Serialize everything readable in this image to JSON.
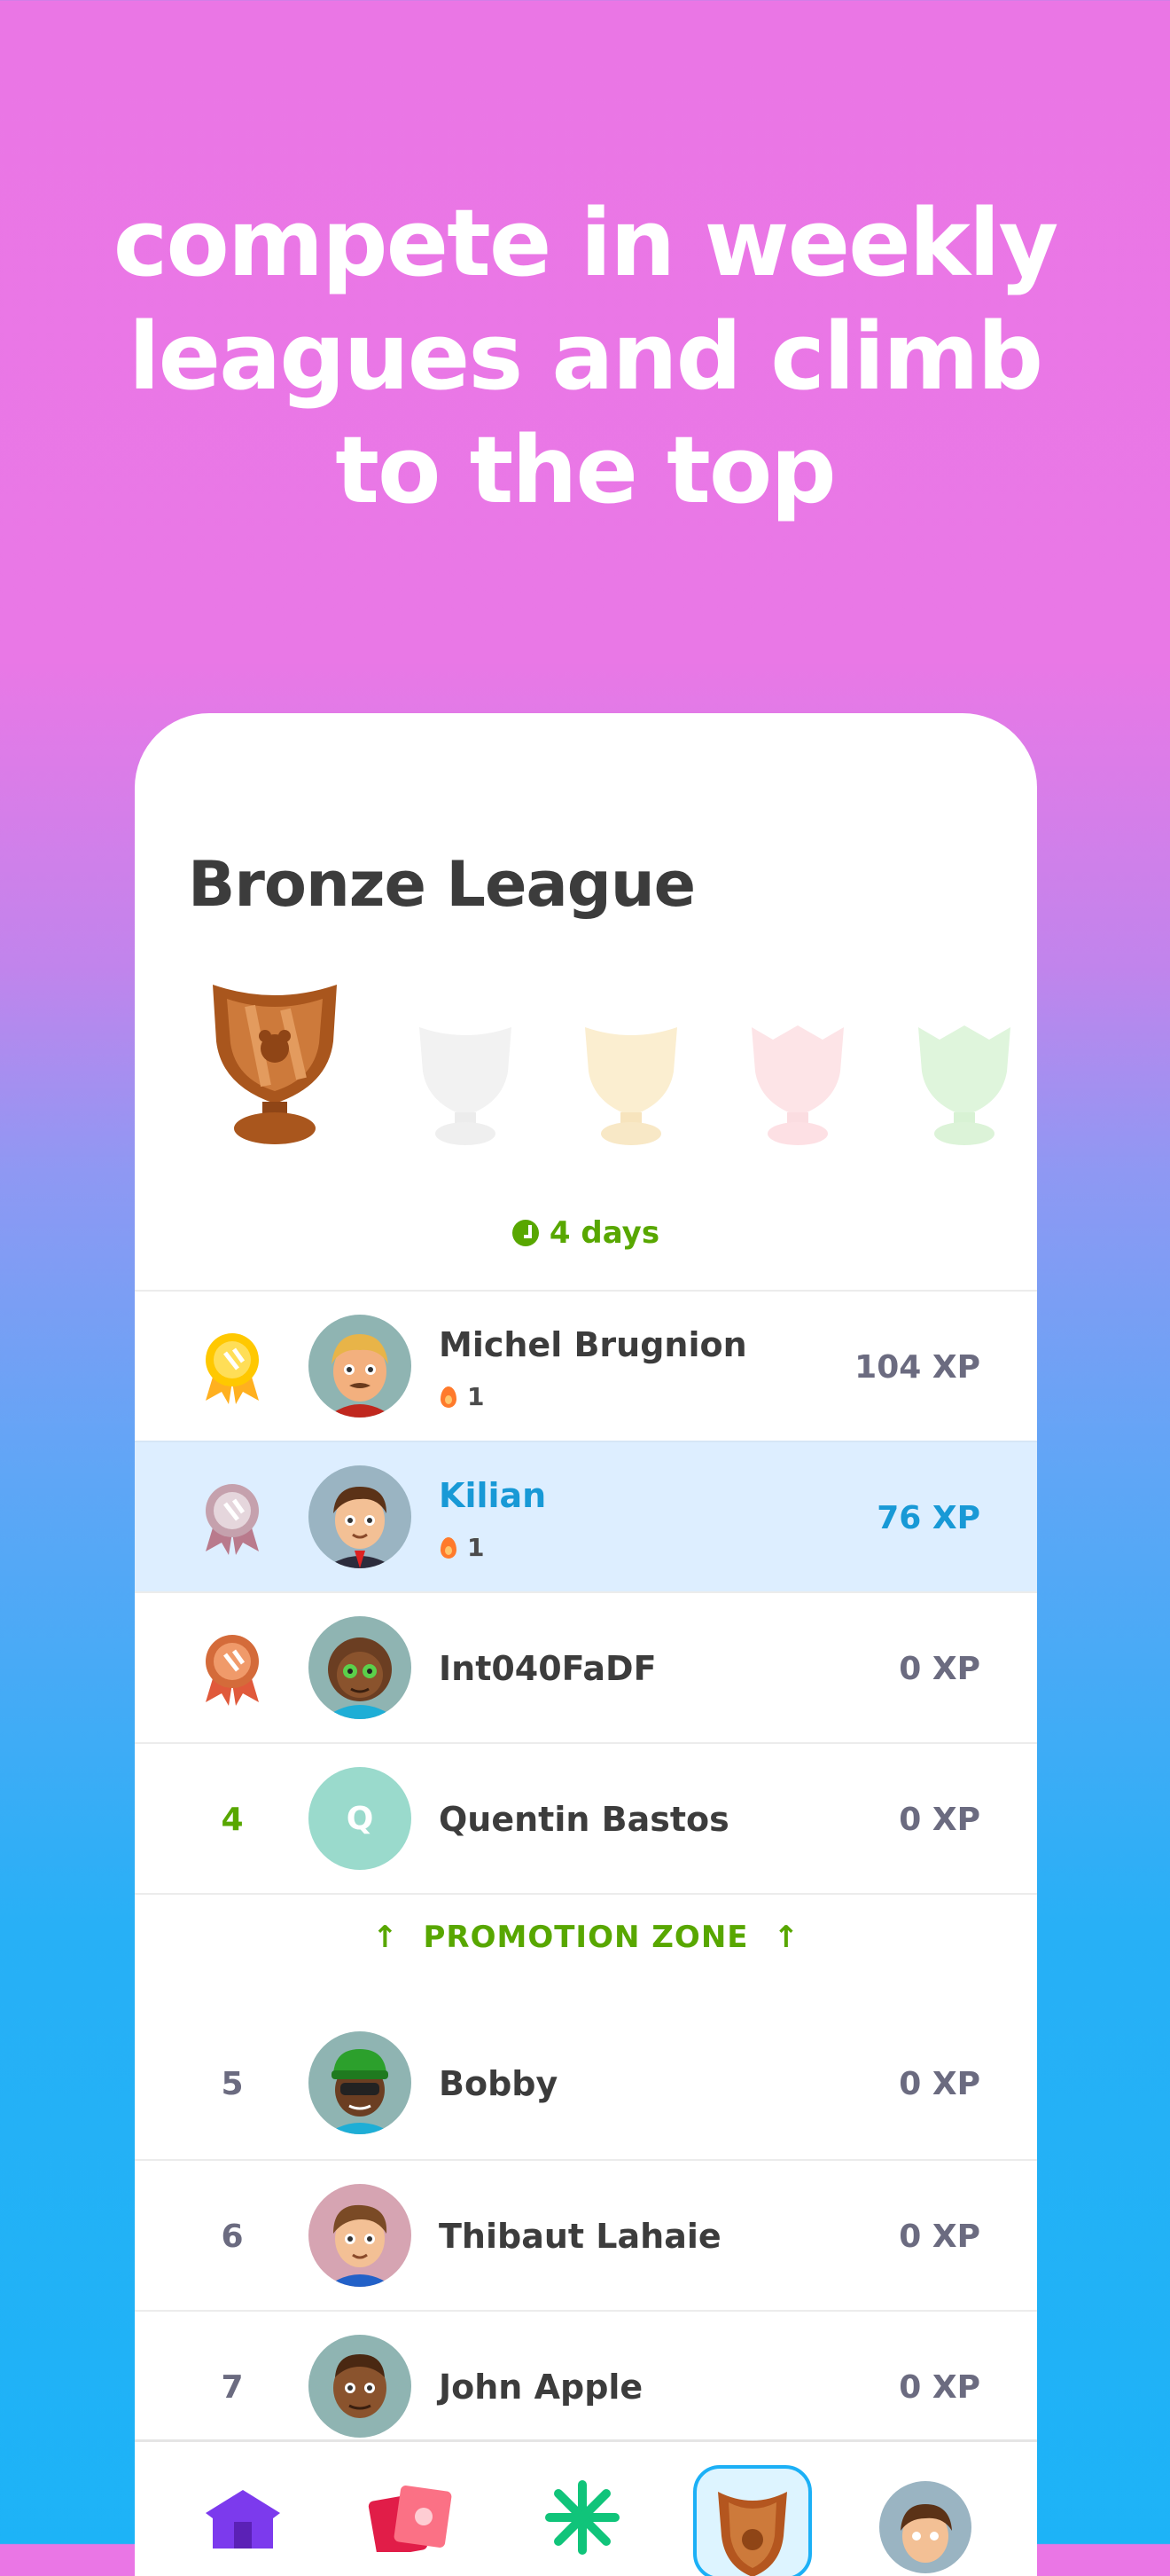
{
  "headline": [
    "compete in weekly",
    "leagues and climb",
    "to the top"
  ],
  "league": {
    "title": "Bronze League",
    "timer": "4 days",
    "promotion_zone_label": "PROMOTION ZONE",
    "xp_unit": "XP"
  },
  "leaderboard": [
    {
      "rank": "1",
      "name": "Michel Brugnion",
      "streak": "1",
      "xp": "104 XP",
      "medal": "gold"
    },
    {
      "rank": "2",
      "name": "Kilian",
      "streak": "1",
      "xp": "76 XP",
      "medal": "silver",
      "current_user": true
    },
    {
      "rank": "3",
      "name": "Int040FaDF",
      "xp": "0 XP",
      "medal": "bronze"
    },
    {
      "rank": "4",
      "name": "Quentin Bastos",
      "avatar_letter": "Q",
      "xp": "0 XP"
    },
    {
      "rank": "5",
      "name": "Bobby",
      "xp": "0 XP"
    },
    {
      "rank": "6",
      "name": "Thibaut Lahaie",
      "xp": "0 XP"
    },
    {
      "rank": "7",
      "name": "John Apple",
      "xp": "0 XP"
    }
  ],
  "colors": {
    "accent_green": "#58a700",
    "current_user_blue": "#1899d6",
    "current_user_bg": "#ddeeff",
    "bronze": "#b4561f"
  },
  "icons": {
    "tabs": [
      "home-icon",
      "letters-icon",
      "characters-icon",
      "leagues-icon",
      "profile-icon"
    ]
  }
}
